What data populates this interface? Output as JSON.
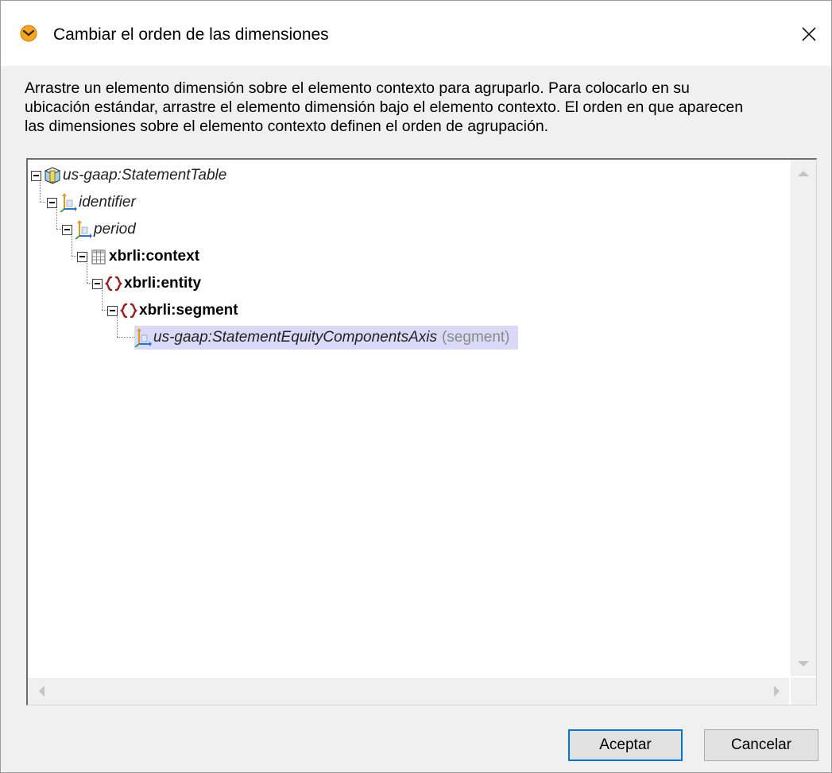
{
  "window": {
    "title": "Cambiar el orden de las dimensiones",
    "icon": "altova-mapforce-icon"
  },
  "instructions": "Arrastre un elemento dimensión sobre el elemento contexto para agruparlo. Para colocarlo en su\nubicación estándar, arrastre el elemento dimensión bajo el elemento contexto. El orden en que aparecen\nlas dimensiones sobre el elemento contexto definen el orden de agrupación.",
  "tree": {
    "nodes": [
      {
        "label": "us-gaap:StatementTable",
        "icon": "hypercube-icon",
        "style": "italic",
        "expanded": true
      },
      {
        "label": "identifier",
        "icon": "dimension-axis-icon",
        "style": "italic",
        "expanded": true
      },
      {
        "label": "period",
        "icon": "dimension-axis-icon",
        "style": "italic",
        "expanded": true
      },
      {
        "label": "xbrli:context",
        "icon": "table-grid-icon",
        "style": "bold",
        "expanded": true
      },
      {
        "label": "xbrli:entity",
        "icon": "curly-braces-icon",
        "style": "bold",
        "expanded": true
      },
      {
        "label": "xbrli:segment",
        "icon": "curly-braces-icon",
        "style": "bold",
        "expanded": true
      },
      {
        "label": "us-gaap:StatementEquityComponentsAxis",
        "suffix": "(segment)",
        "icon": "dimension-axis-icon",
        "style": "italic",
        "selected": true
      }
    ]
  },
  "buttons": {
    "ok": "Aceptar",
    "cancel": "Cancelar"
  },
  "colors": {
    "selection": "#dadaf8",
    "braces": "#9b1c1c",
    "primary_border": "#0078d7"
  }
}
